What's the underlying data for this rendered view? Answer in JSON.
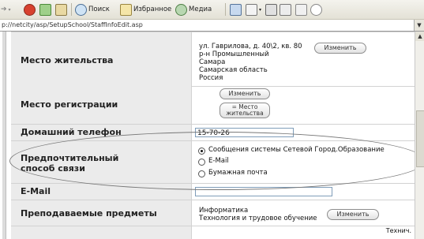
{
  "toolbar": {
    "search": "Поиск",
    "favorites": "Избранное",
    "media": "Медиа"
  },
  "address": {
    "url": "p://netcity/asp/SetupSchool/StaffInfoEdit.asp"
  },
  "rows": {
    "residence": {
      "label": "Место жительства",
      "lines": [
        "ул. Гаврилова, д. 40\\2, кв. 80",
        "р-н Промышленный",
        "Самара",
        "Самарская область",
        "Россия"
      ],
      "button": "Изменить"
    },
    "registration": {
      "label": "Место регистрации",
      "button_change": "Изменить",
      "button_same_line1": "= Место",
      "button_same_line2": "жительства"
    },
    "home_phone": {
      "label": "Домашний телефон",
      "value": "15-70-26"
    },
    "contact": {
      "label_line1": "Предпочтительный",
      "label_line2": "способ связи",
      "options": [
        "Сообщения системы Сетевой Город.Образование",
        "E-Mail",
        "Бумажная почта"
      ],
      "selected": "Сообщения системы Сетевой Город.Образование"
    },
    "email": {
      "label": "E-Mail",
      "value": ""
    },
    "subjects": {
      "label": "Преподаваемые предметы",
      "lines": [
        "Информатика",
        "Технология и трудовое обучение"
      ],
      "button": "Изменить"
    },
    "next": {
      "partial_text": "Технич."
    }
  }
}
